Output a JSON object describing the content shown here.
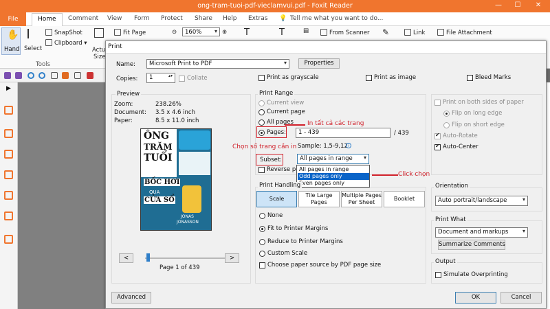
{
  "app": {
    "window_title": "ong-tram-tuoi-pdf-vieclamvui.pdf - Foxit Reader",
    "minimize": "—",
    "maximize": "☐",
    "close": "✕"
  },
  "ribbon": {
    "tabs": [
      "File",
      "Home",
      "Comment",
      "View",
      "Form",
      "Protect",
      "Share",
      "Help",
      "Extras"
    ],
    "search_placeholder": "Tell me what you want to do...",
    "hand": "Hand",
    "select": "Select",
    "snapshot": "SnapShot",
    "clipboard": "Clipboard",
    "tools_group": "Tools",
    "actual_size_1": "Actual",
    "actual_size_2": "Size",
    "fit_page": "Fit Page",
    "zoom": "160%",
    "from_scanner": "From Scanner",
    "link": "Link",
    "file_attachment": "File Attachment"
  },
  "dialog": {
    "title": "Print",
    "printer": {
      "name_label": "Name:",
      "name_value": "Microsoft Print to PDF",
      "properties": "Properties",
      "copies_label": "Copies:",
      "copies_value": "1",
      "collate": "Collate",
      "grayscale": "Print as grayscale",
      "as_image": "Print as image",
      "bleed": "Bleed Marks"
    },
    "preview": {
      "heading": "Preview",
      "zoom_label": "Zoom:",
      "zoom_value": "238.26%",
      "document_label": "Document:",
      "document_value": "3.5 x 4.6 inch",
      "paper_label": "Paper:",
      "paper_value": "8.5 x 11.0 inch",
      "prev": "<",
      "next": ">",
      "page_info": "Page 1 of 439"
    },
    "cover": {
      "line1": "ÔNG",
      "line2": "TRĂM",
      "line3": "TUỔI",
      "line4": "BỐC HƠI",
      "line5": "QUA",
      "line6": "CỬA SỔ",
      "author1": "JONAS",
      "author2": "JONASSON"
    },
    "range": {
      "heading": "Print Range",
      "current_view": "Current view",
      "current_page": "Current page",
      "all_pages": "All pages",
      "pages_label": "Pages:",
      "pages_value": "1 - 439",
      "total": "/ 439",
      "sample": "Sample: 1,5-9,12",
      "subset_label": "Subset:",
      "subset_value": "All pages in range",
      "reverse": "Reverse pa",
      "options": [
        "All pages in range",
        "Odd pages only",
        "Even pages only"
      ]
    },
    "annotations": {
      "all_pages": "In tất cả các trang",
      "choose_pages": "Chọn số trang cần in",
      "click_choose": "Click chọn"
    },
    "handling": {
      "heading": "Print Handling",
      "scale": "Scale",
      "tile": "Tile Large Pages",
      "multiple": "Multiple Pages Per Sheet",
      "booklet": "Booklet",
      "none": "None",
      "fit": "Fit to Printer Margins",
      "reduce": "Reduce to Printer Margins",
      "custom": "Custom Scale",
      "paper_source": "Choose paper source by PDF page size"
    },
    "duplex": {
      "both_sides": "Print on both sides of paper",
      "long_edge": "Flip on long edge",
      "short_edge": "Flip on short edge",
      "auto_rotate": "Auto-Rotate",
      "auto_center": "Auto-Center"
    },
    "orientation": {
      "heading": "Orientation",
      "value": "Auto portrait/landscape"
    },
    "what": {
      "heading": "Print What",
      "value": "Document and markups",
      "summarize": "Summarize Comments"
    },
    "output": {
      "heading": "Output",
      "simulate": "Simulate Overprinting"
    },
    "footer": {
      "advanced": "Advanced",
      "ok": "OK",
      "cancel": "Cancel"
    }
  },
  "colors": {
    "accent": "#f0752e",
    "annotation": "#d0202a",
    "selection": "#0a64c8"
  }
}
